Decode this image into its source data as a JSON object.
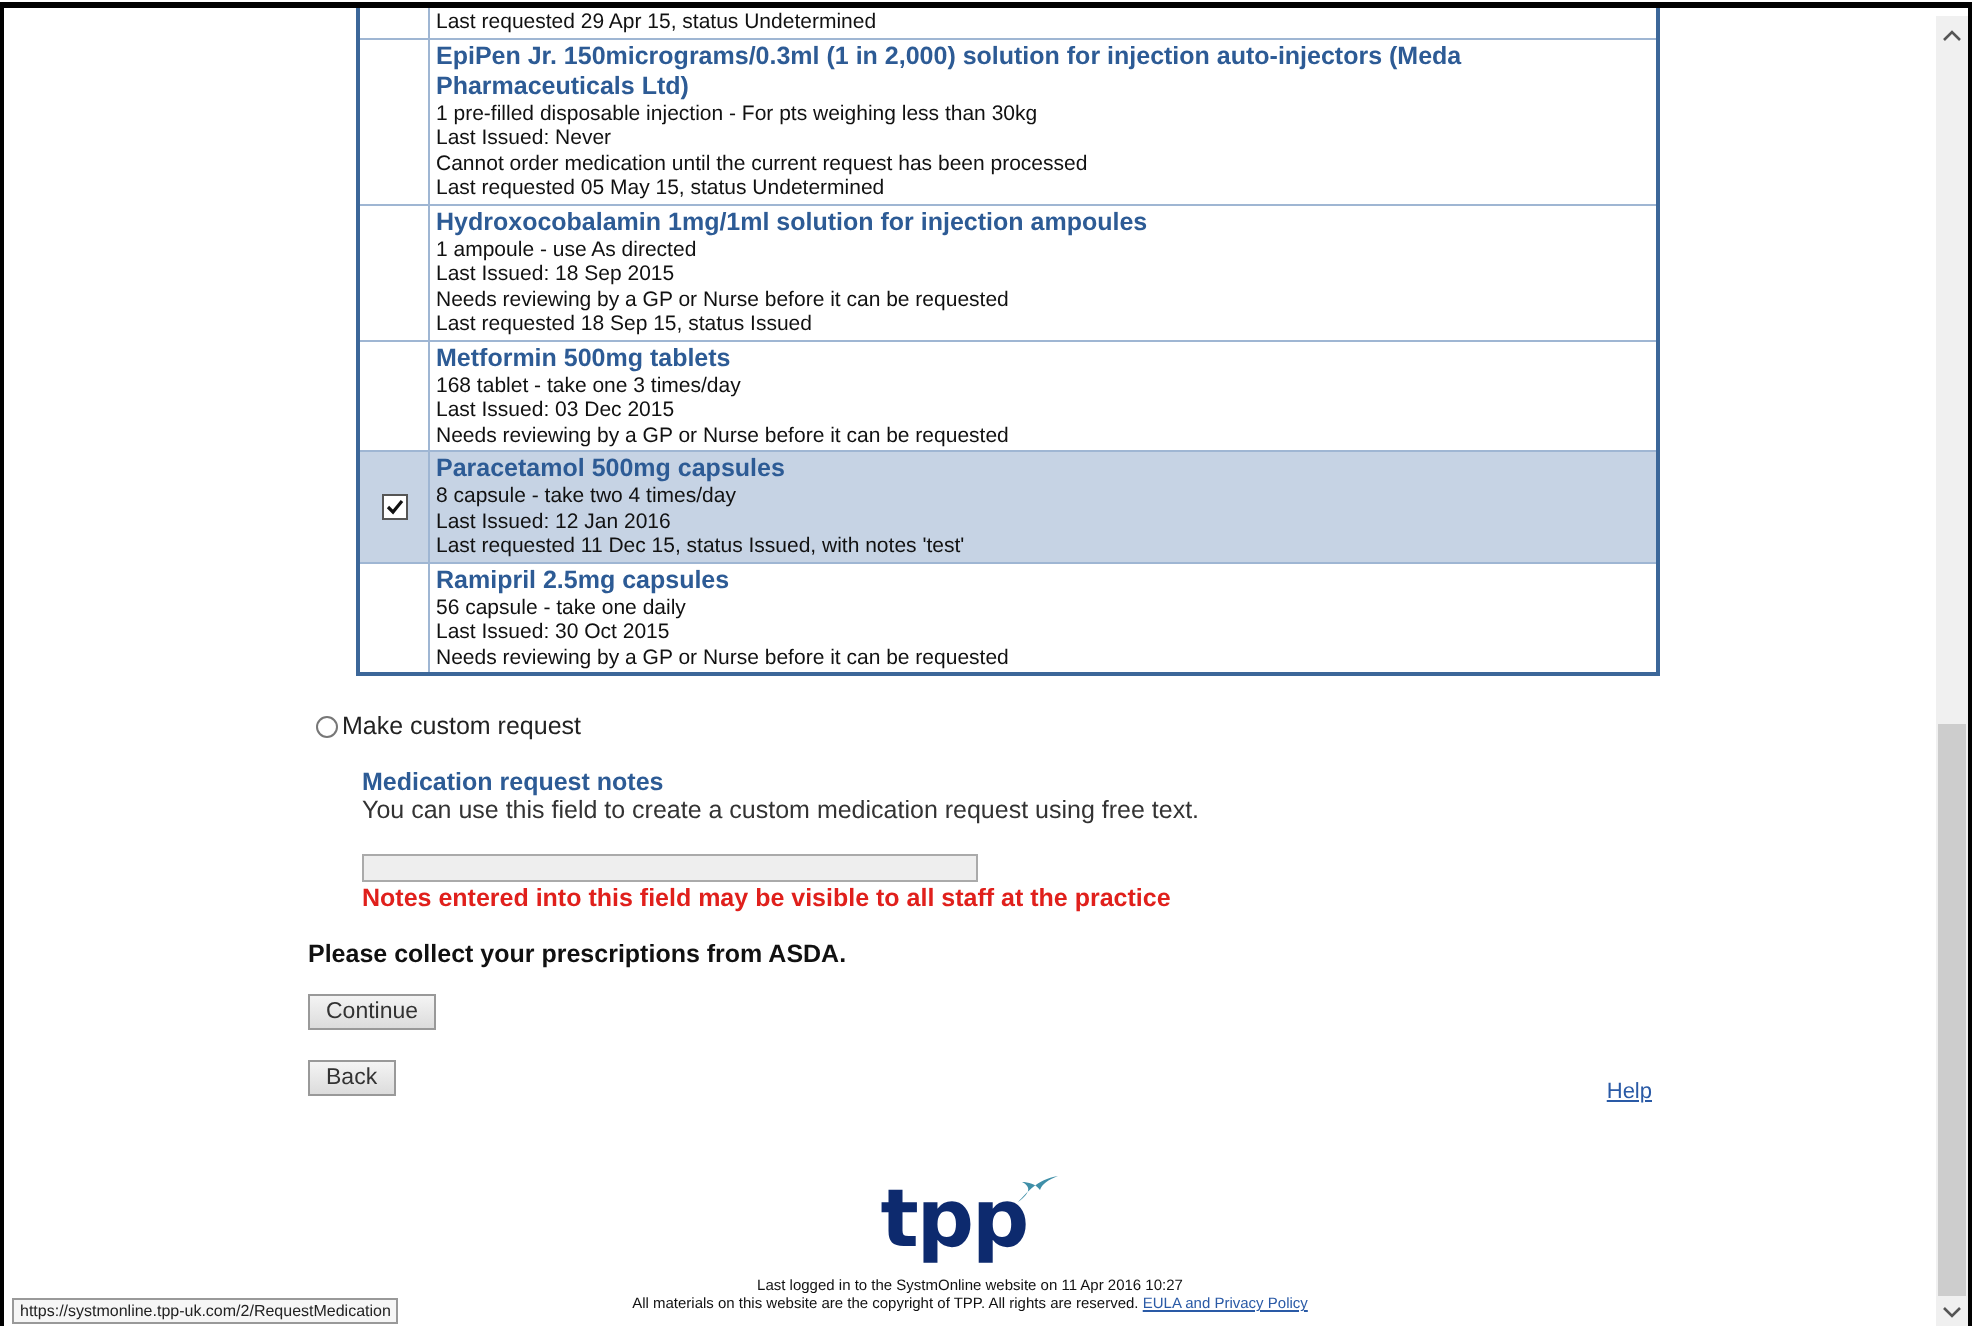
{
  "medications": [
    {
      "selected": false,
      "lines": [
        "Last requested 29 Apr 15, status Undetermined"
      ]
    },
    {
      "name": "EpiPen Jr. 150micrograms/0.3ml (1 in 2,000) solution for injection auto-injectors (Meda Pharmaceuticals Ltd)",
      "selected": false,
      "lines": [
        "1 pre-filled disposable injection - For pts weighing less than 30kg",
        "Last Issued: Never",
        "Cannot order medication until the current request has been processed",
        "Last requested 05 May 15, status Undetermined"
      ]
    },
    {
      "name": "Hydroxocobalamin 1mg/1ml solution for injection ampoules",
      "selected": false,
      "lines": [
        "1 ampoule - use As directed",
        "Last Issued: 18 Sep 2015",
        "Needs reviewing by a GP or Nurse before it can be requested",
        "Last requested 18 Sep 15, status Issued"
      ]
    },
    {
      "name": "Metformin 500mg tablets",
      "selected": false,
      "lines": [
        "168 tablet - take one 3 times/day",
        "Last Issued: 03 Dec 2015",
        "Needs reviewing by a GP or Nurse before it can be requested"
      ]
    },
    {
      "name": "Paracetamol 500mg capsules",
      "selected": true,
      "lines": [
        "8 capsule - take two 4 times/day",
        "Last Issued: 12 Jan 2016",
        "Last requested 11 Dec 15, status Issued, with notes 'test'"
      ]
    },
    {
      "name": "Ramipril 2.5mg capsules",
      "selected": false,
      "lines": [
        "56 capsule - take one daily",
        "Last Issued: 30 Oct 2015",
        "Needs reviewing by a GP or Nurse before it can be requested"
      ]
    }
  ],
  "custom_request": {
    "label": "Make custom request",
    "selected": false
  },
  "notes": {
    "heading": "Medication request notes",
    "description": "You can use this field to create a custom medication request using free text.",
    "warning": "Notes entered into this field may be visible to all staff at the practice"
  },
  "collect_message": "Please collect your prescriptions from ASDA.",
  "buttons": [
    "Continue",
    "Back"
  ],
  "help_link": "Help",
  "logo": "tpp",
  "footer": {
    "last_login": "Last logged in to the SystmOnline website on 11 Apr 2016 10:27",
    "copyright": "All materials on this website are the copyright of TPP. All rights are reserved.",
    "link": "EULA and Privacy Policy"
  },
  "status_url": "https://systmonline.tpp-uk.com/2/RequestMedication"
}
